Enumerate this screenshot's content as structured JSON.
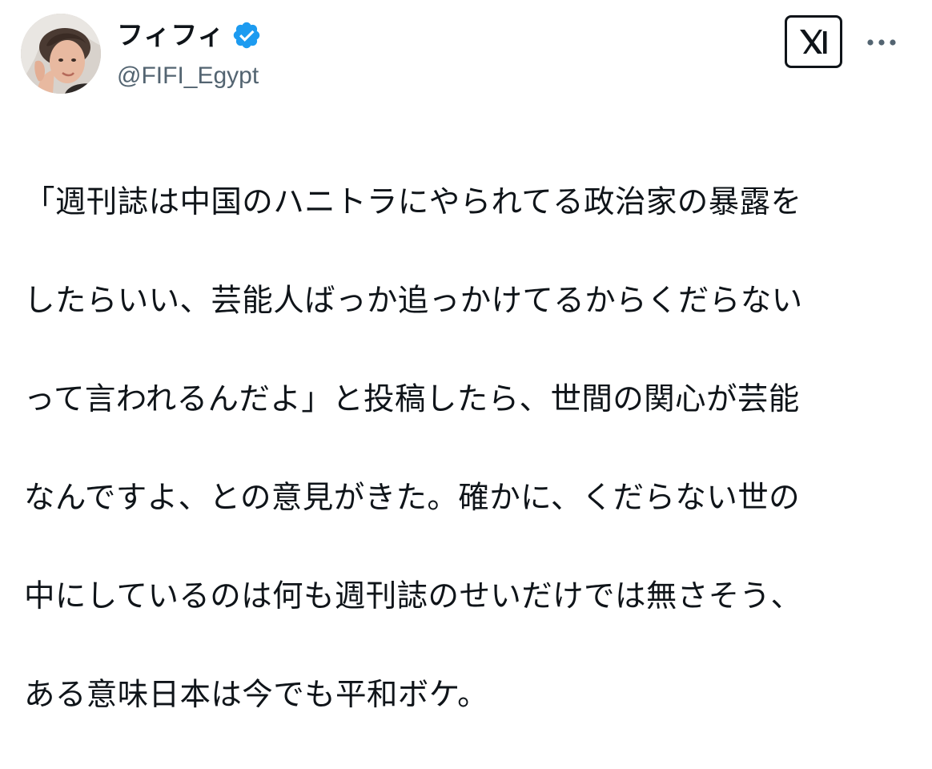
{
  "author": {
    "display_name": "フィフィ",
    "handle": "@FIFI_Egypt",
    "verified": true,
    "verified_color": "#1d9bf0",
    "avatar_icon": "profile-photo-avatar"
  },
  "actions": {
    "x_logo_icon": "x-logo-icon",
    "more_icon": "more-dots-icon"
  },
  "tweet": {
    "lines": [
      "「週刊誌は中国のハニトラにやられてる政治家の暴露を",
      "したらいい、芸能人ばっか追っかけてるからくだらない",
      "って言われるんだよ」と投稿したら、世間の関心が芸能",
      "なんですよ、との意見がきた。確かに、くだらない世の",
      "中にしているのは何も週刊誌のせいだけでは無さそう、",
      "ある意味日本は今でも平和ボケ。"
    ]
  },
  "colors": {
    "text": "#0f1419",
    "secondary_text": "#536471",
    "background": "#ffffff"
  }
}
